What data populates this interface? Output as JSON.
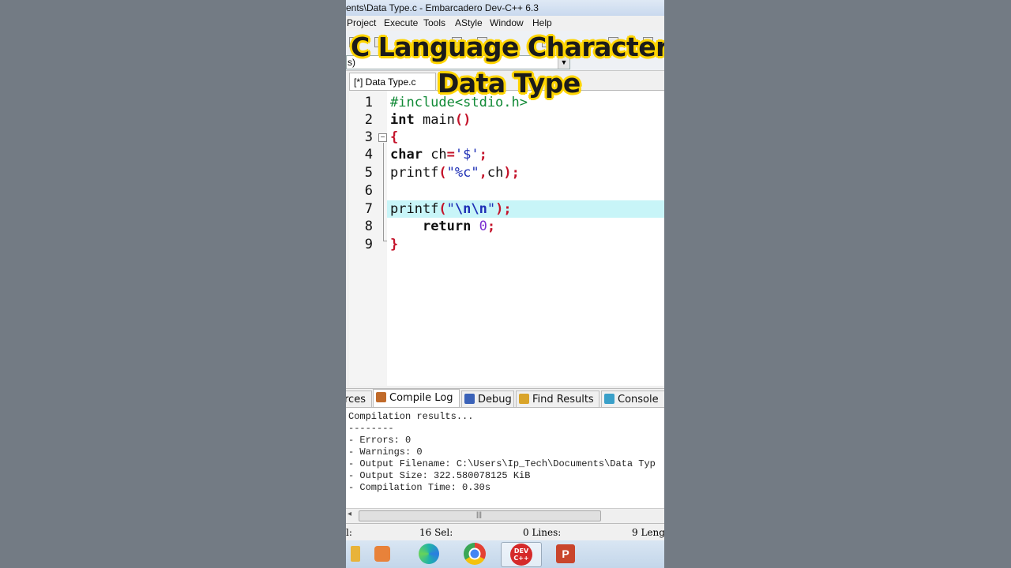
{
  "window": {
    "title": "ents\\Data Type.c - Embarcadero Dev-C++ 6.3"
  },
  "menu": {
    "items": [
      "Project",
      "Execute",
      "Tools",
      "AStyle",
      "Window",
      "Help"
    ]
  },
  "toolbar": {
    "combo_value": "s)"
  },
  "overlay": {
    "line1": "C Language Character",
    "line2": "Data Type"
  },
  "editor": {
    "tab_label": "[*] Data Type.c",
    "line_numbers": [
      "1",
      "2",
      "3",
      "4",
      "5",
      "6",
      "7",
      "8",
      "9"
    ],
    "highlighted_line": 7,
    "lines": [
      "#include<stdio.h>",
      "int main()",
      "{",
      "char ch='$';",
      "printf(\"%c\",ch);",
      "",
      "printf(\"\\n\\n\");",
      "    return 0;",
      "}"
    ]
  },
  "bottom_panel": {
    "tabs": [
      {
        "label": "rces",
        "icon": "resources-icon"
      },
      {
        "label": "Compile Log",
        "icon": "compile-log-icon",
        "active": true
      },
      {
        "label": "Debug",
        "icon": "debug-icon"
      },
      {
        "label": "Find Results",
        "icon": "find-results-icon"
      },
      {
        "label": "Console",
        "icon": "console-icon"
      }
    ],
    "log_lines": [
      "Compilation results...",
      "--------",
      "- Errors: 0",
      "- Warnings: 0",
      "- Output Filename: C:\\Users\\Ip_Tech\\Documents\\Data Typ",
      "- Output Size: 322.580078125 KiB",
      "- Compilation Time: 0.30s"
    ]
  },
  "statusbar": {
    "col": "l:",
    "sel": "16 Sel:",
    "lines": "0 Lines:",
    "length": "9 Leng"
  },
  "taskbar": {
    "items": [
      "folder-icon",
      "media-player-icon",
      "edge-icon",
      "chrome-icon",
      "devcpp-icon",
      "powerpoint-icon"
    ],
    "devcpp_label": "DEV\nC++"
  },
  "colors": {
    "overlay_outline": "#ffd400",
    "highlight_line": "#c8f5f8",
    "keyword": "#111111",
    "preprocessor": "#118a36",
    "string": "#1e2fb5",
    "symbol": "#c4132a",
    "number": "#7b2fd1"
  }
}
